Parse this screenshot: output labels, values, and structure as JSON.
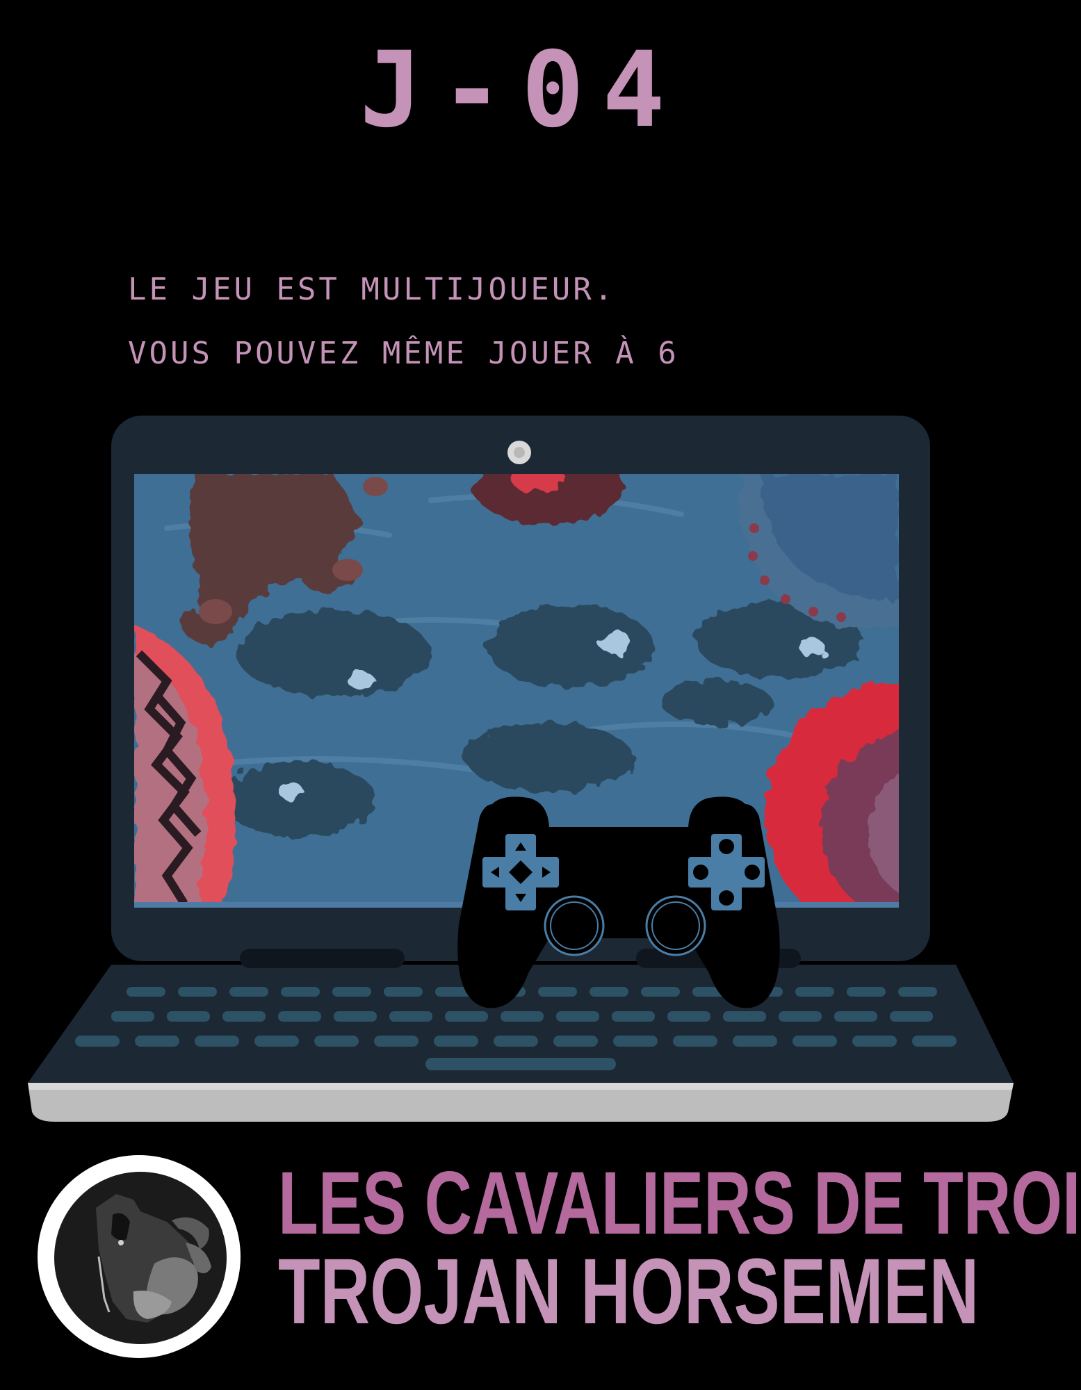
{
  "countdown": "J-04",
  "message": {
    "line1": "LE JEU EST MULTIJOUEUR.",
    "line2": "VOUS POUVEZ MÊME JOUER À 6"
  },
  "brand": {
    "name_fr": "LES CAVALIERS DE TROIE",
    "name_en": "TROJAN HORSEMEN"
  },
  "illustration": {
    "main": "laptop-with-game-screen",
    "overlay": "gamepad-controller",
    "logo": "horse-head-logo"
  },
  "colors": {
    "background": "#000000",
    "text_pink": "#c493b7",
    "brand_magenta": "#b56a9e",
    "laptop_body": "#1c2834",
    "screen_blue": "#3f6f94",
    "keys": "#2d5266"
  }
}
